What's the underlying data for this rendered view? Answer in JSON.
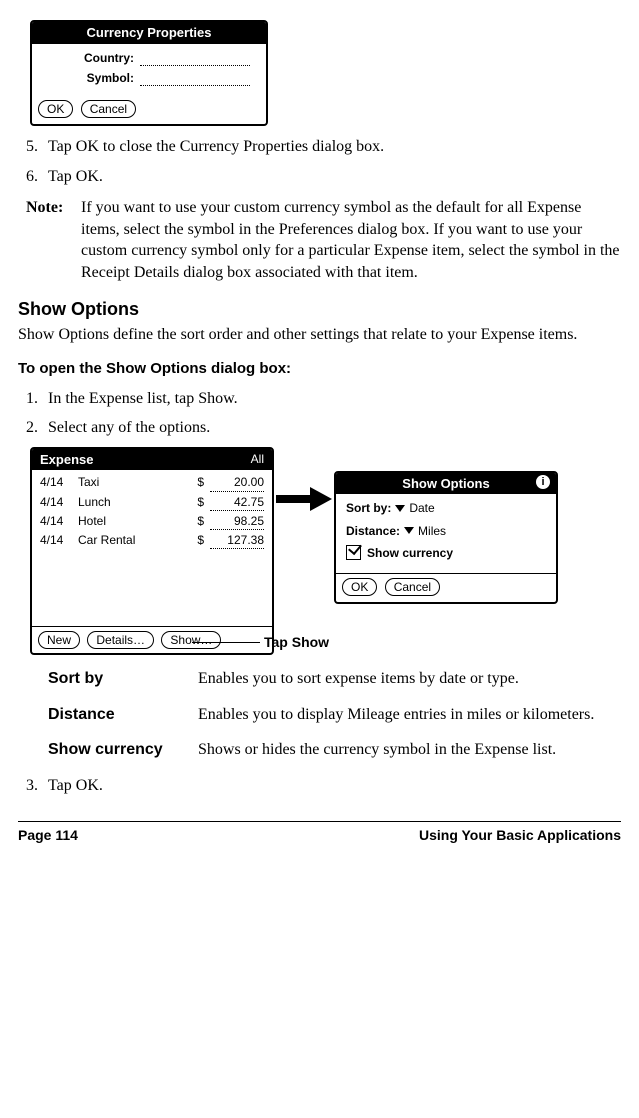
{
  "currency_dialog": {
    "title": "Currency Properties",
    "country_label": "Country:",
    "symbol_label": "Symbol:",
    "ok": "OK",
    "cancel": "Cancel"
  },
  "steps_a": {
    "s5_num": "5.",
    "s5_text": "Tap OK to close the Currency Properties dialog box.",
    "s6_num": "6.",
    "s6_text": "Tap OK."
  },
  "note": {
    "label": "Note:",
    "text": "If you want to use your custom currency symbol as the default for all Expense items, select the symbol in the Preferences dialog box. If you want to use your custom currency symbol only for a particular Expense item, select the symbol in the Receipt Details dialog box associated with that item."
  },
  "show_options": {
    "heading": "Show Options",
    "intro": "Show Options define the sort order and other settings that relate to your Expense items.",
    "subhead": "To open the Show Options dialog box:",
    "s1_num": "1.",
    "s1_text": "In the Expense list, tap Show.",
    "s2_num": "2.",
    "s2_text": "Select any of the options."
  },
  "expense_dialog": {
    "title": "Expense",
    "filter": "All",
    "rows": [
      {
        "date": "4/14",
        "desc": "Taxi",
        "cur": "$",
        "amt": "20.00"
      },
      {
        "date": "4/14",
        "desc": "Lunch",
        "cur": "$",
        "amt": "42.75"
      },
      {
        "date": "4/14",
        "desc": "Hotel",
        "cur": "$",
        "amt": "98.25"
      },
      {
        "date": "4/14",
        "desc": "Car Rental",
        "cur": "$",
        "amt": "127.38"
      }
    ],
    "btn_new": "New",
    "btn_details": "Details…",
    "btn_show": "Show…"
  },
  "show_opts_dialog": {
    "title": "Show Options",
    "sort_label": "Sort by:",
    "sort_val": "Date",
    "dist_label": "Distance:",
    "dist_val": "Miles",
    "show_cur": "Show currency",
    "ok": "OK",
    "cancel": "Cancel"
  },
  "tap_show_label": "Tap Show",
  "definitions": {
    "sort_term": "Sort by",
    "sort_desc": "Enables you to sort expense items by date or type.",
    "dist_term": "Distance",
    "dist_desc": "Enables you to display Mileage entries in miles or kilometers.",
    "cur_term": "Show currency",
    "cur_desc": "Shows or hides the currency symbol in the Expense list."
  },
  "steps_b": {
    "s3_num": "3.",
    "s3_text": "Tap OK."
  },
  "footer": {
    "page": "Page 114",
    "section": "Using Your Basic Applications"
  }
}
